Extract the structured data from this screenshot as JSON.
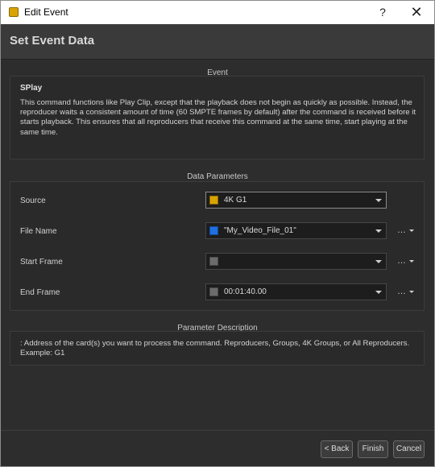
{
  "window": {
    "title": "Edit Event",
    "help_glyph": "?",
    "close_glyph": "✕",
    "app_icon_color": "#d9a300"
  },
  "header": {
    "title": "Set Event Data"
  },
  "event_section": {
    "title": "Event",
    "name": "SPlay",
    "description": "This command functions like Play Clip, except that the playback does not begin as quickly as possible. Instead, the reproducer waits a consistent amount of time (60 SMPTE frames by default) after the command is received before it starts playback. This ensures that all reproducers that receive this command at the same time, start playing at the same time."
  },
  "params_section": {
    "title": "Data Parameters",
    "more_glyph": "…",
    "params": [
      {
        "label": "Source",
        "value": "4K G1",
        "swatch_color": "#d9a300",
        "has_more": false
      },
      {
        "label": "File Name",
        "value": "\"My_Video_File_01\"",
        "swatch_color": "#1e6fe0",
        "has_more": true
      },
      {
        "label": "Start Frame",
        "value": "",
        "swatch_color": "#6b6b6b",
        "has_more": true
      },
      {
        "label": "End Frame",
        "value": "00:01:40.00",
        "swatch_color": "#6b6b6b",
        "has_more": true
      }
    ]
  },
  "param_description": {
    "title": "Parameter Description",
    "text": ": Address of the card(s) you want to process the command. Reproducers, Groups, 4K Groups, or All Reproducers. Example: G1"
  },
  "footer": {
    "back_label": "< Back",
    "finish_label": "Finish",
    "cancel_label": "Cancel"
  }
}
